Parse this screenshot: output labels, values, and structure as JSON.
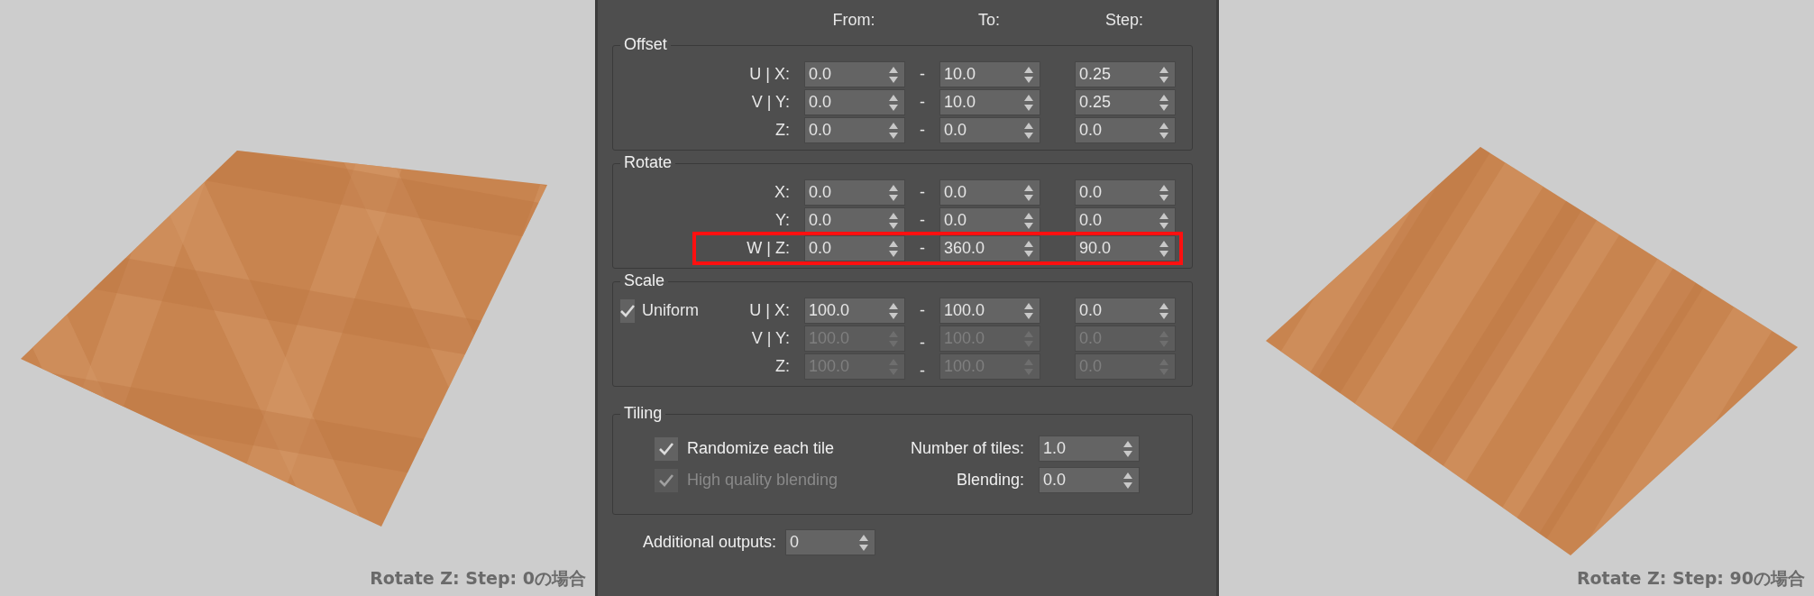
{
  "viewports": [
    {
      "caption": "Rotate Z: Step: 0の場合"
    },
    {
      "caption": "Rotate Z: Step: 90の場合"
    }
  ],
  "panel": {
    "column_headers": [
      "From:",
      "To:",
      "Step:"
    ],
    "groups": [
      {
        "title": "Offset",
        "rows": [
          {
            "label": "U | X:",
            "from": "0.0",
            "separator": "-",
            "to": "10.0",
            "step": "0.25",
            "disabled": false,
            "highlighted": false
          },
          {
            "label": "V | Y:",
            "from": "0.0",
            "separator": "-",
            "to": "10.0",
            "step": "0.25",
            "disabled": false,
            "highlighted": false
          },
          {
            "label": "Z:",
            "from": "0.0",
            "separator": "-",
            "to": "0.0",
            "step": "0.0",
            "disabled": false,
            "highlighted": false
          }
        ]
      },
      {
        "title": "Rotate",
        "rows": [
          {
            "label": "X:",
            "from": "0.0",
            "separator": "-",
            "to": "0.0",
            "step": "0.0",
            "disabled": false,
            "highlighted": false
          },
          {
            "label": "Y:",
            "from": "0.0",
            "separator": "-",
            "to": "0.0",
            "step": "0.0",
            "disabled": false,
            "highlighted": false
          },
          {
            "label": "W | Z:",
            "from": "0.0",
            "separator": "-",
            "to": "360.0",
            "step": "90.0",
            "disabled": false,
            "highlighted": true
          }
        ]
      },
      {
        "title": "Scale",
        "uniform": {
          "label": "Uniform",
          "checked": true
        },
        "rows": [
          {
            "label": "U | X:",
            "from": "100.0",
            "separator": "-",
            "to": "100.0",
            "step": "0.0",
            "disabled": false,
            "highlighted": false
          },
          {
            "label": "V | Y:",
            "from": "100.0",
            "separator": "-",
            "to": "100.0",
            "step": "0.0",
            "disabled": true,
            "highlighted": false
          },
          {
            "label": "Z:",
            "from": "100.0",
            "separator": "-",
            "to": "100.0",
            "step": "0.0",
            "disabled": true,
            "highlighted": false
          }
        ]
      }
    ],
    "tiling": {
      "title": "Tiling",
      "rows": [
        {
          "checkbox": {
            "label": "Randomize each tile",
            "checked": true,
            "disabled": false
          },
          "spinner": {
            "label": "Number of tiles:",
            "value": "1.0"
          }
        },
        {
          "checkbox": {
            "label": "High quality blending",
            "checked": true,
            "disabled": true
          },
          "spinner": {
            "label": "Blending:",
            "value": "0.0"
          }
        }
      ]
    },
    "additional_outputs": {
      "label": "Additional outputs:",
      "value": "0"
    }
  }
}
